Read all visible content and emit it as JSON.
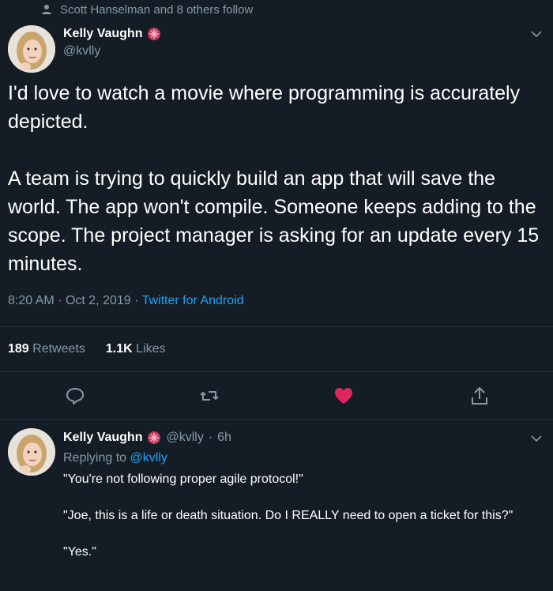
{
  "social_context": {
    "text": "Scott Hanselman and 8 others follow"
  },
  "tweet": {
    "author": {
      "name": "Kelly Vaughn",
      "handle": "@kvlly"
    },
    "paragraphs": [
      "I'd love to watch a movie where programming is accurately depicted.",
      "A team is trying to quickly build an app that will save the world. The app won't compile. Someone keeps adding to the scope. The project manager is asking for an update every 15 minutes."
    ],
    "time": "8:20 AM",
    "sep": "·",
    "date": "Oct 2, 2019",
    "client": "Twitter for Android",
    "retweets_count": "189",
    "retweets_label": "Retweets",
    "likes_count": "1.1K",
    "likes_label": "Likes"
  },
  "reply": {
    "author": {
      "name": "Kelly Vaughn",
      "handle": "@kvlly",
      "sep": "·",
      "time": "6h"
    },
    "replying_prefix": "Replying to",
    "replying_to": "@kvlly",
    "lines": [
      "\"You're not following proper agile protocol!\"",
      "\"Joe, this is a life or death situation. Do I REALLY need to open a ticket for this?\"",
      "\"Yes.\""
    ]
  },
  "colors": {
    "background": "#141d26",
    "muted_text": "#8899a6",
    "link": "#1da1f2",
    "like_heart": "#e0245e"
  },
  "icons": [
    "person-icon",
    "badge-icon",
    "chevron-down-icon",
    "reply-icon",
    "retweet-icon",
    "heart-icon",
    "share-icon"
  ]
}
